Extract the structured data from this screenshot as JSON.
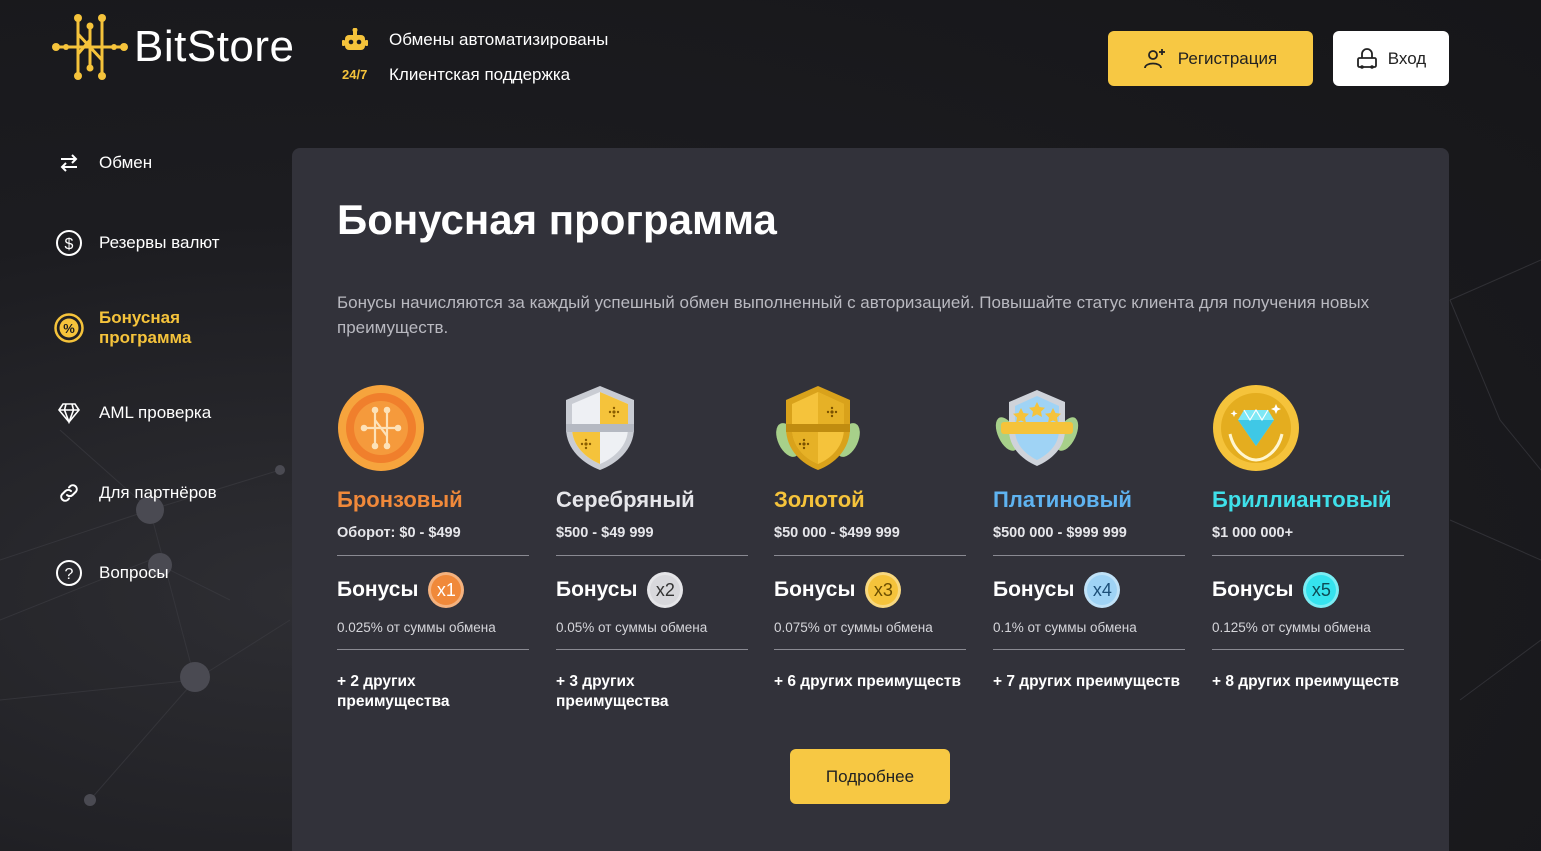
{
  "header": {
    "logo_text": "BitStore",
    "info": [
      {
        "icon": "robot-icon",
        "text": "Обмены автоматизированы"
      },
      {
        "icon": "support-24-7-icon",
        "badge": "24/7",
        "text": "Клиентская поддержка"
      }
    ],
    "register_label": "Регистрация",
    "login_label": "Вход"
  },
  "sidebar": {
    "items": [
      {
        "label": "Обмен",
        "icon": "exchange-arrows-icon",
        "active": false
      },
      {
        "label": "Резервы валют",
        "icon": "dollar-circle-icon",
        "active": false
      },
      {
        "label": "Бонусная программа",
        "icon": "percent-circle-icon",
        "active": true
      },
      {
        "label": "AML проверка",
        "icon": "diamond-icon",
        "active": false
      },
      {
        "label": "Для партнёров",
        "icon": "link-icon",
        "active": false
      },
      {
        "label": "Вопросы",
        "icon": "question-circle-icon",
        "active": false
      }
    ]
  },
  "main": {
    "title": "Бонусная программа",
    "description": "Бонусы начисляются за каждый успешный обмен выполненный с авторизацией. Повышайте статус клиента для получения новых преимуществ.",
    "tiers": [
      {
        "name": "Бронзовый",
        "range": "Оборот: $0 - $499",
        "bonus_label": "Бонусы",
        "multiplier": "x1",
        "percent": "0.025% от суммы обмена",
        "more": "+ 2 других преимущества",
        "color": "#f0893a",
        "badge_color": "#f0893a",
        "badge_text_color": "#ffffff",
        "icon": "bronze-medal-icon"
      },
      {
        "name": "Серебряный",
        "range": "$500 - $49 999",
        "bonus_label": "Бонусы",
        "multiplier": "x2",
        "percent": "0.05% от суммы обмена",
        "more": "+ 3 других преимущества",
        "color": "#e6e6ea",
        "badge_color": "#d8d8dc",
        "badge_text_color": "#333333",
        "icon": "silver-shield-icon"
      },
      {
        "name": "Золотой",
        "range": "$50 000 - $499 999",
        "bonus_label": "Бонусы",
        "multiplier": "x3",
        "percent": "0.075% от суммы обмена",
        "more": "+ 6 других преимуществ",
        "color": "#f5c33b",
        "badge_color": "#f5c33b",
        "badge_text_color": "#6b4e00",
        "icon": "gold-shield-icon"
      },
      {
        "name": "Платиновый",
        "range": "$500 000 - $999 999",
        "bonus_label": "Бонусы",
        "multiplier": "x4",
        "percent": "0.1% от суммы обмена",
        "more": "+ 7 других преимуществ",
        "color": "#5fb3f0",
        "badge_color": "#9fd3f5",
        "badge_text_color": "#1d4f78",
        "icon": "platinum-crest-icon"
      },
      {
        "name": "Бриллиантовый",
        "range": "$1 000 000+",
        "bonus_label": "Бонусы",
        "multiplier": "x5",
        "percent": "0.125% от суммы обмена",
        "more": "+ 8 других преимуществ",
        "color": "#3fe0ea",
        "badge_color": "#35e3ee",
        "badge_text_color": "#0d4b55",
        "icon": "diamond-medal-icon"
      }
    ],
    "more_button_label": "Подробнее"
  },
  "colors": {
    "accent": "#f7c843",
    "card_bg": "#32323a",
    "page_bg": "#1c1c20"
  }
}
